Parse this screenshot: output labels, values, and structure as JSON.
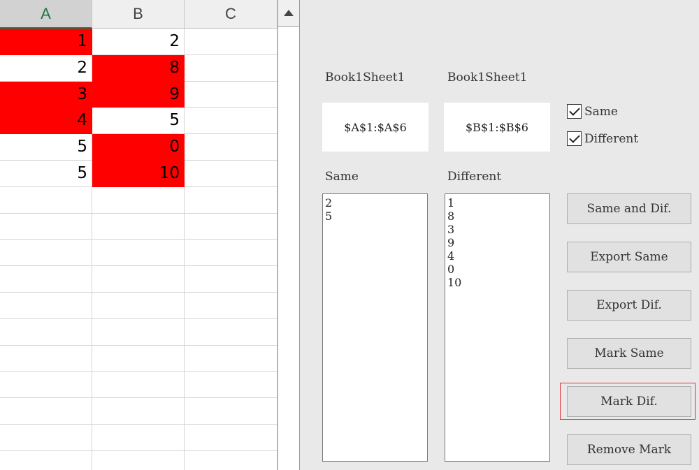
{
  "sheet": {
    "columns": [
      "A",
      "B",
      "C"
    ],
    "rows": [
      [
        {
          "v": "1",
          "red": true
        },
        {
          "v": "2",
          "red": false
        }
      ],
      [
        {
          "v": "2",
          "red": false
        },
        {
          "v": "8",
          "red": true
        }
      ],
      [
        {
          "v": "3",
          "red": true
        },
        {
          "v": "9",
          "red": true
        }
      ],
      [
        {
          "v": "4",
          "red": true
        },
        {
          "v": "5",
          "red": false
        }
      ],
      [
        {
          "v": "5",
          "red": false
        },
        {
          "v": "0",
          "red": true
        }
      ],
      [
        {
          "v": "5",
          "red": false
        },
        {
          "v": "10",
          "red": true
        }
      ],
      [],
      [],
      [],
      [],
      [],
      [],
      [],
      [],
      [],
      [],
      []
    ],
    "highlight_color": "#ff0000"
  },
  "panel": {
    "range1_label": "Book1Sheet1",
    "range2_label": "Book1Sheet1",
    "range1_value": "$A$1:$A$6",
    "range2_value": "$B$1:$B$6",
    "chk_same": "Same",
    "chk_different": "Different",
    "same_label": "Same",
    "different_label": "Different",
    "same_list": [
      "2",
      "5"
    ],
    "different_list": [
      "1",
      "8",
      "3",
      "9",
      "4",
      "0",
      "10"
    ],
    "buttons": {
      "same_and_dif": "Same and Dif.",
      "export_same": "Export Same",
      "export_dif": "Export Dif.",
      "mark_same": "Mark Same",
      "mark_dif": "Mark Dif.",
      "remove_mark": "Remove Mark"
    },
    "focus_outline_color": "#e0303a"
  }
}
